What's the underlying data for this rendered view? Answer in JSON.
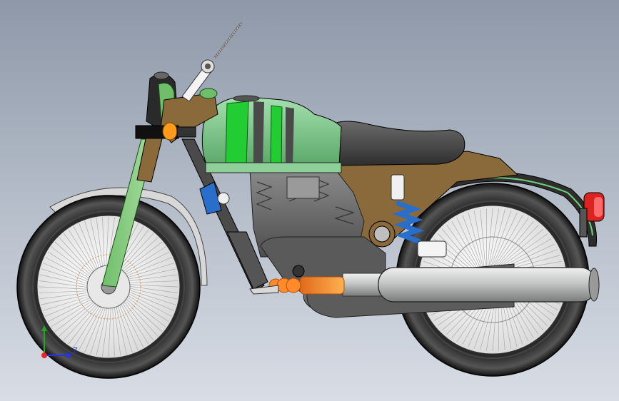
{
  "viewport": {
    "background_top": "#8e98a8",
    "background_bottom": "#d8dde5"
  },
  "model": {
    "subject": "motorcycle-3d-cad-model",
    "colors": {
      "frame_bronze": "#8a6a3a",
      "tank_green": "#7cc88a",
      "tank_stripe": "#22cc33",
      "tire": "#222222",
      "rim_white": "#f2f2f2",
      "exhaust_silver": "#c9cccc",
      "exhaust_hot": "#ff8a2a",
      "engine_gray": "#6e6e6e",
      "seat": "#4a4a4a",
      "spring_blue": "#2a6ecc",
      "tail_light_red": "#dd2222"
    }
  },
  "triad": {
    "axis_z_label": "Z",
    "icon": "coordinate-triad-icon"
  }
}
